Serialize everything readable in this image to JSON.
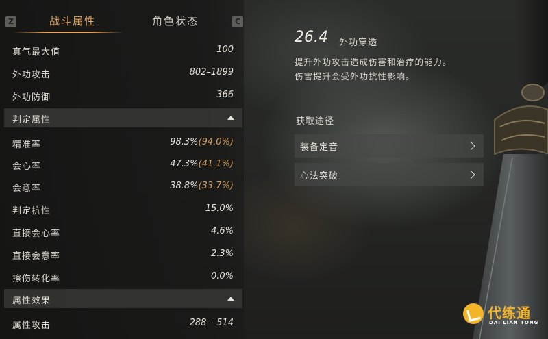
{
  "tabs": {
    "key_left": "Z",
    "key_right": "C",
    "active": "战斗属性",
    "inactive": "角色状态"
  },
  "stats_top": [
    {
      "label": "真气最大值",
      "value": "100"
    },
    {
      "label": "外功攻击",
      "value": "802–1899"
    },
    {
      "label": "外功防御",
      "value": "366"
    }
  ],
  "section_judge": {
    "label": "判定属性"
  },
  "judge_stats": [
    {
      "label": "精准率",
      "value": "98.3%",
      "paren": "(94.0%)"
    },
    {
      "label": "会心率",
      "value": "47.3%",
      "paren": "(41.1%)"
    },
    {
      "label": "会意率",
      "value": "38.8%",
      "paren": "(33.7%)"
    },
    {
      "label": "判定抗性",
      "value": "15.0%",
      "paren": ""
    },
    {
      "label": "直接会心率",
      "value": "4.6%",
      "paren": ""
    },
    {
      "label": "直接会意率",
      "value": "2.3%",
      "paren": ""
    },
    {
      "label": "擦伤转化率",
      "value": "0.0%",
      "paren": ""
    }
  ],
  "section_effect": {
    "label": "属性效果"
  },
  "effect_stats": [
    {
      "label": "属性攻击",
      "value": "288 – 514"
    }
  ],
  "detail": {
    "value": "26.4",
    "name": "外功穿透",
    "desc_lines": [
      "提升外功攻击造成伤害和治疗的能力。",
      "伤害提升会受外功抗性影响。"
    ]
  },
  "acquire": {
    "title": "获取途径",
    "items": [
      "装备定音",
      "心法突破"
    ]
  },
  "logo": {
    "text": "代练通",
    "sub": "DAI LIAN TONG"
  },
  "colors": {
    "accent": "#e3a865",
    "paren": "#d3a167",
    "logo": "#f2b52a"
  }
}
